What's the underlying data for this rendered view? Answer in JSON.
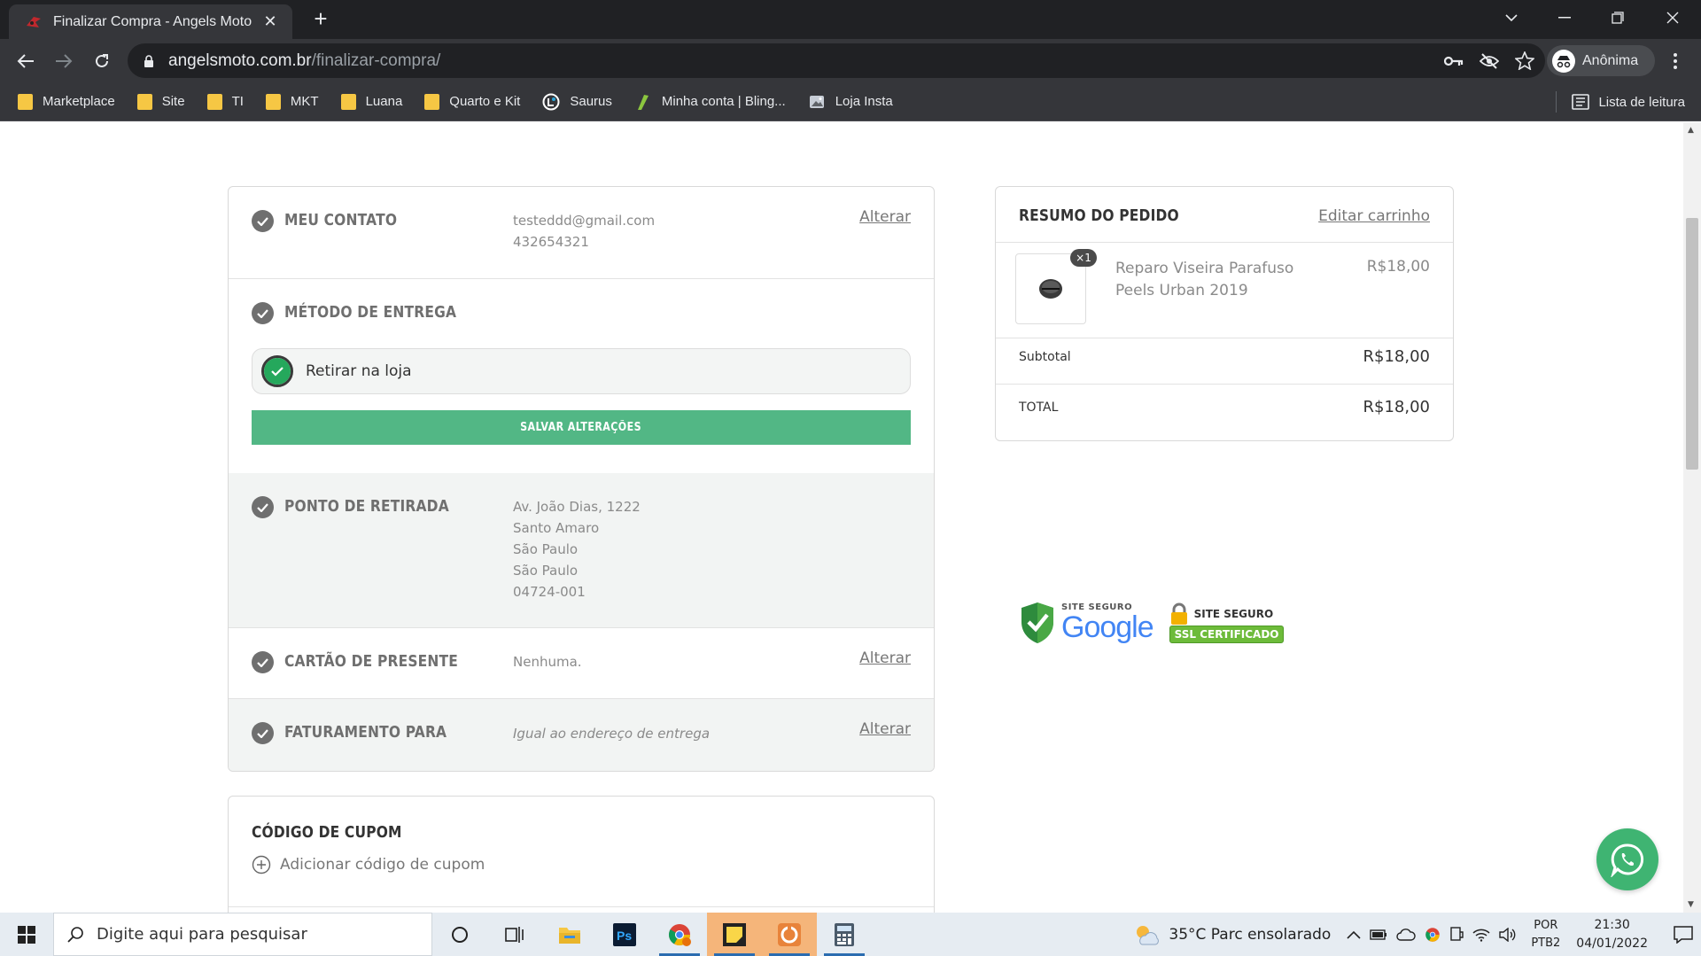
{
  "browser": {
    "tab_title": "Finalizar Compra - Angels Moto",
    "url_host": "angelsmoto.com.br",
    "url_path": "/finalizar-compra/",
    "profile_label": "Anônima",
    "bookmarks": [
      "Marketplace",
      "Site",
      "TI",
      "MKT",
      "Luana",
      "Quarto e Kit",
      "Saurus",
      "Minha conta | Bling...",
      "Loja Insta"
    ],
    "reading_list": "Lista de leitura"
  },
  "checkout": {
    "contact": {
      "heading": "MEU CONTATO",
      "email": "testeddd@gmail.com",
      "phone": "432654321",
      "change": "Alterar"
    },
    "shipping": {
      "heading": "MÉTODO DE ENTREGA",
      "option": "Retirar na loja",
      "save_button": "SALVAR ALTERAÇÕES"
    },
    "pickup": {
      "heading": "PONTO DE RETIRADA",
      "address": [
        "Av. João Dias, 1222",
        "Santo Amaro",
        "São Paulo",
        "São Paulo",
        "04724-001"
      ]
    },
    "gift_card": {
      "heading": "CARTÃO DE PRESENTE",
      "value": "Nenhuma.",
      "change": "Alterar"
    },
    "billing": {
      "heading": "FATURAMENTO PARA",
      "value": "Igual ao endereço de entrega",
      "change": "Alterar"
    },
    "coupon": {
      "heading": "CÓDIGO DE CUPOM",
      "add_label": "Adicionar código de cupom"
    }
  },
  "summary": {
    "heading": "RESUMO DO PEDIDO",
    "edit_cart": "Editar carrinho",
    "item": {
      "qty": "×1",
      "name": "Reparo Viseira Parafuso Peels Urban 2019",
      "price": "R$18,00"
    },
    "subtotal_label": "Subtotal",
    "subtotal_value": "R$18,00",
    "total_label": "TOTAL",
    "total_value": "R$18,00"
  },
  "badges": {
    "google_top": "SITE SEGURO",
    "google_word": "Google",
    "ssl_top": "SITE SEGURO",
    "ssl_bottom": "SSL CERTIFICADO"
  },
  "taskbar": {
    "search_placeholder": "Digite aqui para pesquisar",
    "weather": "35°C  Parc ensolarado",
    "lang_top": "POR",
    "lang_bottom": "PTB2",
    "time": "21:30",
    "date": "04/01/2022"
  },
  "colors": {
    "accent_green": "#52b785",
    "whatsapp_green": "#3fb472",
    "check_gray": "#6f6f6f"
  }
}
